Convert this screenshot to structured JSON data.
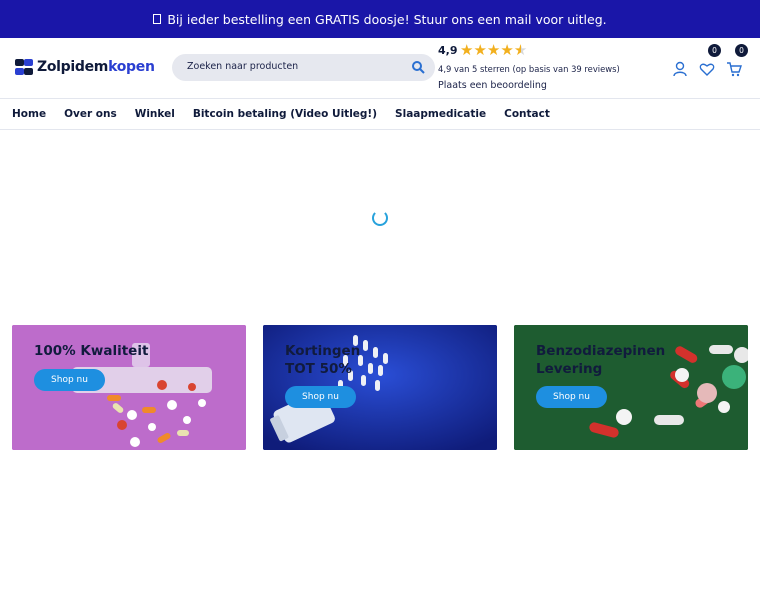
{
  "announcement": {
    "icon": "gift-icon",
    "text": "Bij ieder bestelling een GRATIS doosje! Stuur ons een mail voor uitleg."
  },
  "header": {
    "logo_part1": "Zolpidem",
    "logo_part2": "kopen",
    "search_placeholder": "Zoeken naar producten",
    "rating": {
      "score": "4,9",
      "stars": 4.5,
      "summary": "4,9 van 5 sterren (op basis van 39 reviews)",
      "link": "Plaats een beoordeling"
    },
    "wishlist_count": "0",
    "cart_count": "0"
  },
  "nav": [
    "Home",
    "Over ons",
    "Winkel",
    "Bitcoin betaling (Video Uitleg!)",
    "Slaapmedicatie",
    "Contact"
  ],
  "cards": [
    {
      "title": "100% Kwaliteit",
      "button": "Shop nu"
    },
    {
      "title_line1": "Kortingen",
      "title_line2": "TOT 50%",
      "button": "Shop nu"
    },
    {
      "title_line1": "Benzodiazepinen",
      "title_line2": "Levering",
      "button": "Shop nu"
    }
  ],
  "colors": {
    "topbar": "#1a16a8",
    "accent": "#2a3fd1",
    "button": "#1e8fe0",
    "stars": "#f2b01e"
  }
}
